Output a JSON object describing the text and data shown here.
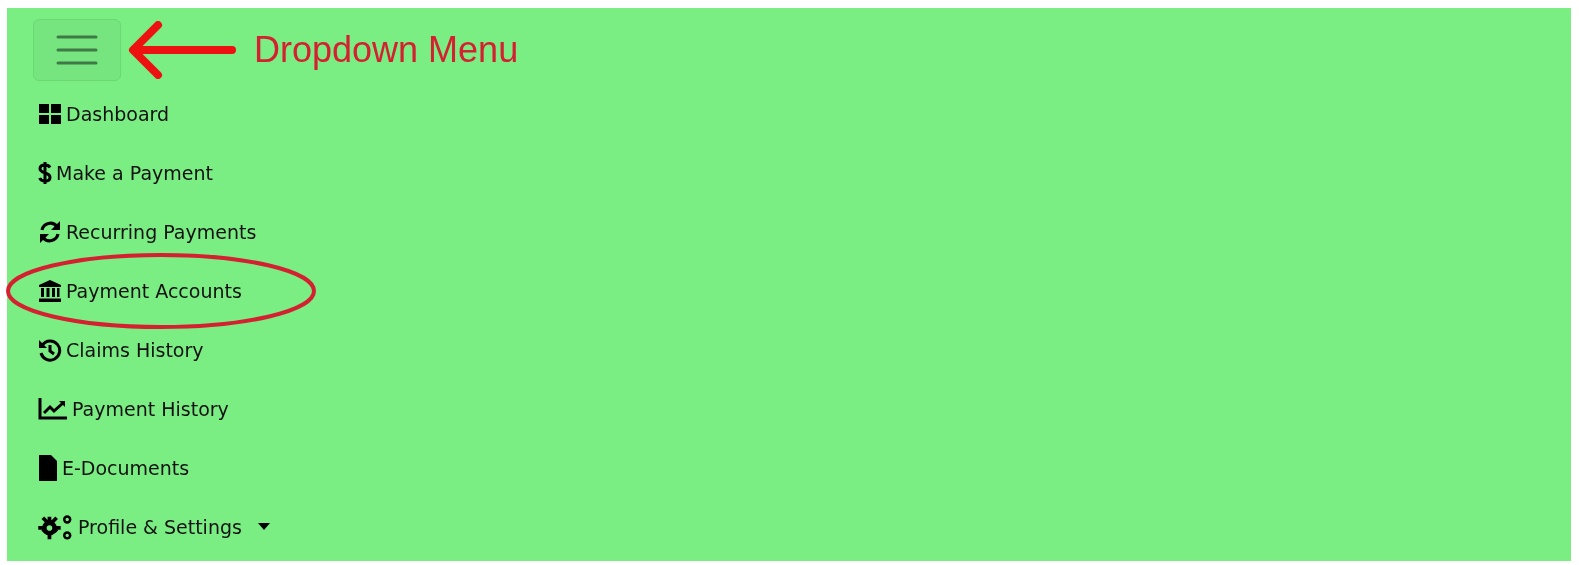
{
  "menu_button": {
    "label": "Dropdown Menu"
  },
  "nav_items": [
    {
      "label": "Dashboard",
      "circled": false,
      "dropdown": false
    },
    {
      "label": "Make a Payment",
      "circled": false,
      "dropdown": false
    },
    {
      "label": "Recurring Payments",
      "circled": false,
      "dropdown": false
    },
    {
      "label": "Payment Accounts",
      "circled": true,
      "dropdown": false
    },
    {
      "label": "Claims History",
      "circled": false,
      "dropdown": false
    },
    {
      "label": "Payment History",
      "circled": false,
      "dropdown": false
    },
    {
      "label": "E-Documents",
      "circled": false,
      "dropdown": false
    },
    {
      "label": "Profile & Settings",
      "circled": false,
      "dropdown": true
    }
  ]
}
